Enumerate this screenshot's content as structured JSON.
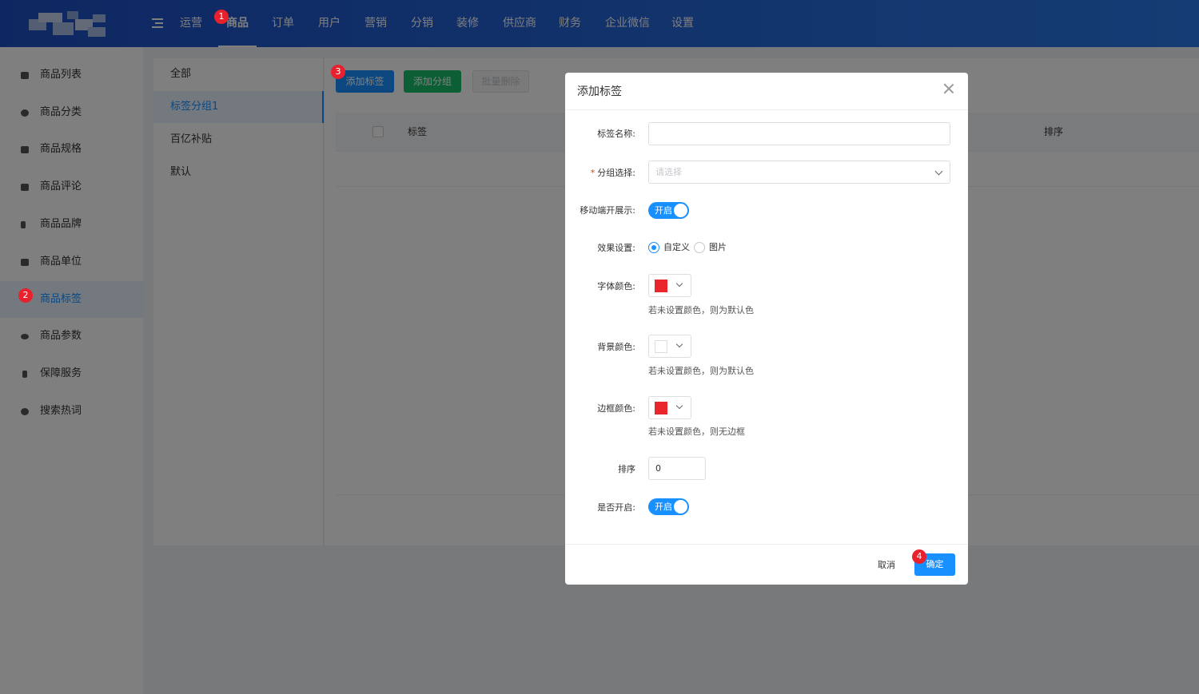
{
  "topbar": {
    "nav": [
      "运营",
      "商品",
      "订单",
      "用户",
      "营销",
      "分销",
      "装修",
      "供应商",
      "财务",
      "企业微信",
      "设置"
    ],
    "active": "商品"
  },
  "sidebar": {
    "items": [
      {
        "label": "商品列表",
        "icon": "basket-icon"
      },
      {
        "label": "商品分类",
        "icon": "category-icon"
      },
      {
        "label": "商品规格",
        "icon": "cube-icon"
      },
      {
        "label": "商品评论",
        "icon": "comment-icon"
      },
      {
        "label": "商品品牌",
        "icon": "brand-icon"
      },
      {
        "label": "商品单位",
        "icon": "grid-icon"
      },
      {
        "label": "商品标签",
        "icon": "tag-icon"
      },
      {
        "label": "商品参数",
        "icon": "eye-icon"
      },
      {
        "label": "保障服务",
        "icon": "shield-icon"
      },
      {
        "label": "搜索热词",
        "icon": "globe-icon"
      }
    ],
    "active": "商品标签"
  },
  "groups": {
    "items": [
      "全部",
      "标签分组1",
      "百亿补贴",
      "默认"
    ],
    "active": "标签分组1"
  },
  "toolbar": {
    "add_tag": "添加标签",
    "add_group": "添加分组",
    "batch_delete": "批量删除"
  },
  "table": {
    "headers": {
      "tag": "标签",
      "sort": "排序"
    }
  },
  "modal": {
    "title": "添加标签",
    "fields": {
      "name_label": "标签名称:",
      "name_value": "",
      "group_label": "分组选择:",
      "group_placeholder": "请选择",
      "mobile_label": "移动端开展示:",
      "mobile_switch": "开启",
      "effect_label": "效果设置:",
      "effect_custom": "自定义",
      "effect_image": "图片",
      "font_color_label": "字体颜色:",
      "font_color_hint": "若未设置颜色，则为默认色",
      "bg_color_label": "背景颜色:",
      "bg_color_hint": "若未设置颜色，则为默认色",
      "border_color_label": "边框颜色:",
      "border_color_hint": "若未设置颜色，则无边框",
      "sort_label": "排序",
      "sort_value": "0",
      "enabled_label": "是否开启:",
      "enabled_switch": "开启"
    },
    "cancel": "取消",
    "ok": "确定"
  },
  "colors": {
    "primary": "#1890ff",
    "green": "#19be6b",
    "font_color": "#e8262c",
    "bg_color": "#ffffff",
    "border_color": "#e8262c",
    "badge": "#e8222d"
  },
  "badges": [
    "1",
    "2",
    "3",
    "4"
  ]
}
